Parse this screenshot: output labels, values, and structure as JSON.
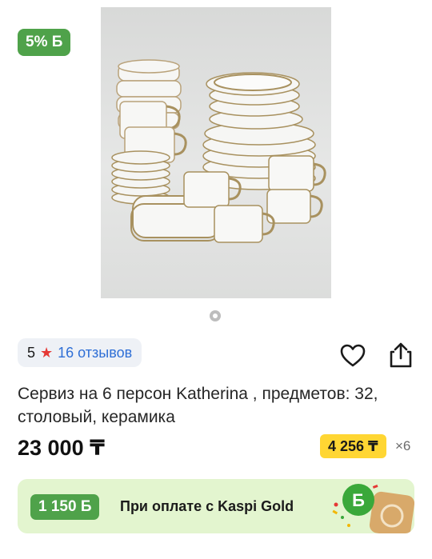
{
  "bonus_badge": "5% Б",
  "gallery": {
    "image_alt": "Сервиз на 6 персон Katherina",
    "page_count": 1,
    "current": 1
  },
  "rating": {
    "value": "5",
    "reviews": "16 отзывов"
  },
  "actions": {
    "favorite_icon": "heart-icon",
    "share_icon": "share-icon"
  },
  "product": {
    "title": "Сервиз на 6 персон Katherina , предметов: 32, столовый, керамика"
  },
  "price": {
    "main": "23 000 ₸",
    "installment": "4 256 ₸",
    "months": "×6"
  },
  "kaspi_gold": {
    "bonus": "1 150 Б",
    "text": "При оплате с Kaspi Gold",
    "colors": {
      "bg": "#e3f5cf",
      "badge": "#4fa24a"
    }
  }
}
